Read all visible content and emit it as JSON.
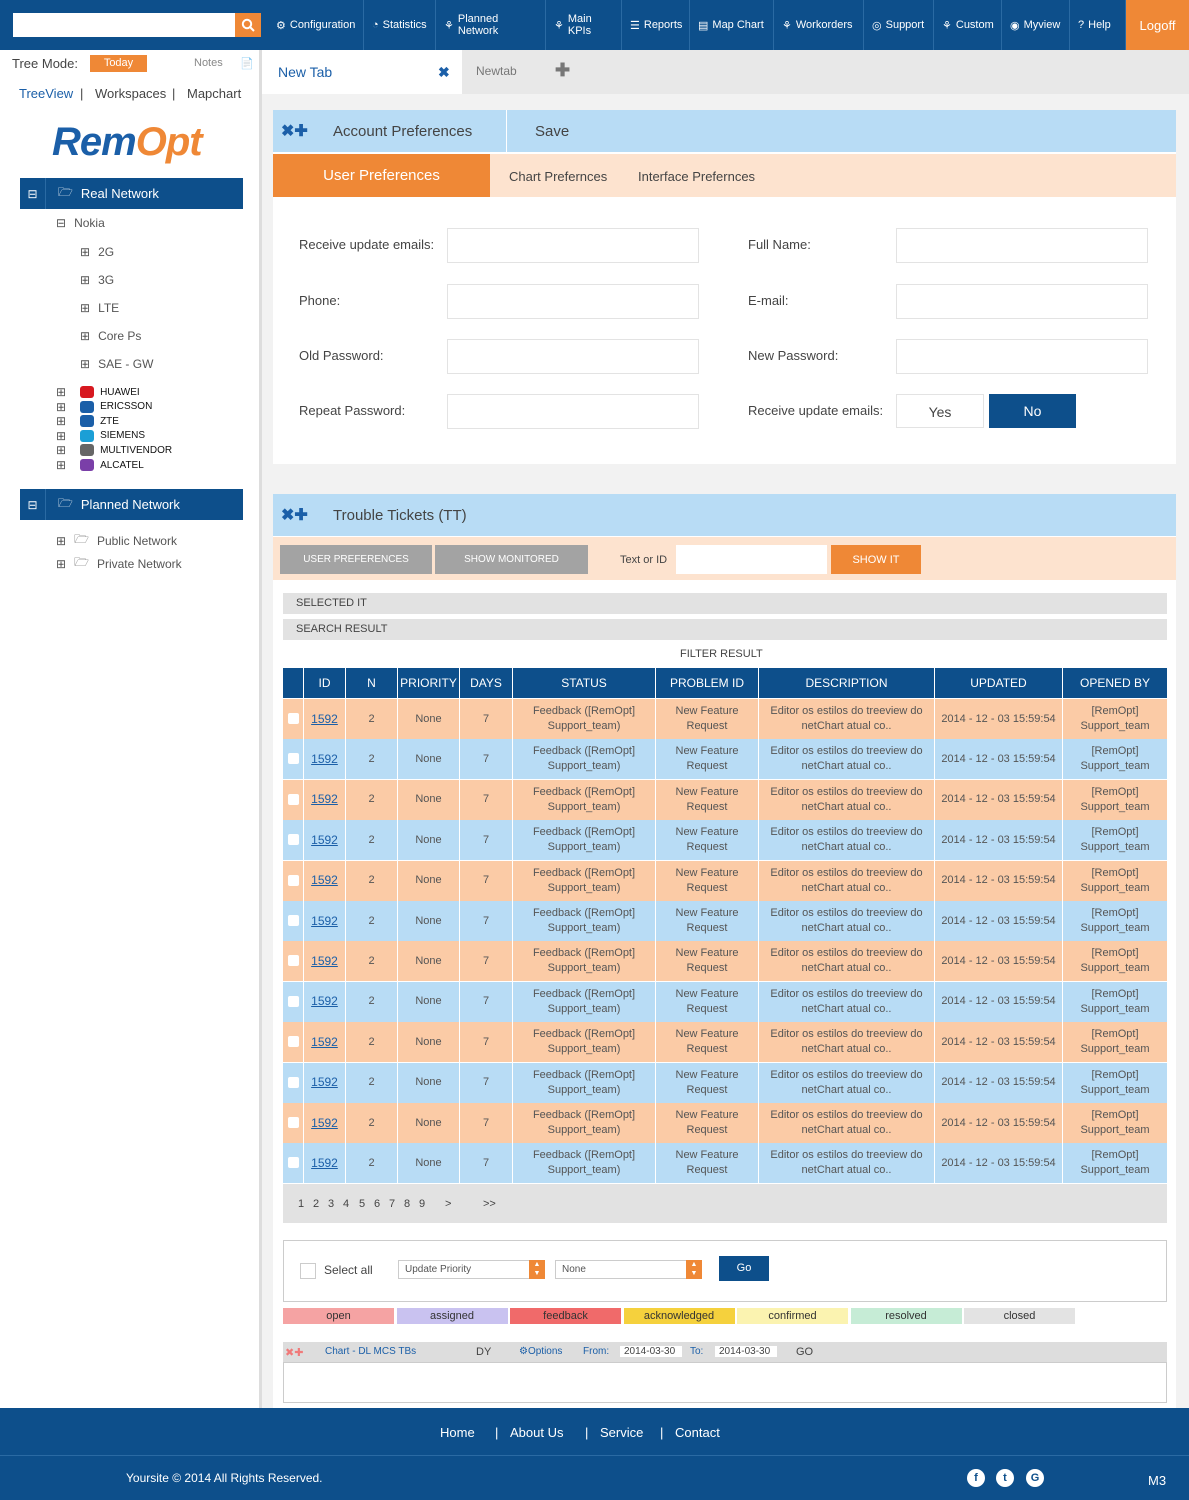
{
  "nav": {
    "search_placeholder": "",
    "items": [
      {
        "label": "Configuration",
        "icon": "gear-icon"
      },
      {
        "label": "Statistics",
        "icon": "pie-chart-icon"
      },
      {
        "label": "Planned Network",
        "icon": "network-icon"
      },
      {
        "label": "Main KPIs",
        "icon": "network-icon"
      },
      {
        "label": "Reports",
        "icon": "document-icon"
      },
      {
        "label": "Map Chart",
        "icon": "map-icon"
      },
      {
        "label": "Workorders",
        "icon": "network-icon"
      },
      {
        "label": "Support",
        "icon": "lifebuoy-icon"
      },
      {
        "label": "Custom",
        "icon": "network-icon"
      },
      {
        "label": "Myview",
        "icon": "globe-icon"
      },
      {
        "label": "Help",
        "icon": "question-icon"
      }
    ],
    "logoff": "Logoff"
  },
  "sidebar": {
    "tree_mode_label": "Tree Mode:",
    "today": "Today",
    "notes": "Notes",
    "views": [
      "TreeView",
      "Workspaces",
      "Mapchart"
    ],
    "separator": "|",
    "logo_a": "Rem",
    "logo_b": "Opt",
    "real_network": "Real Network",
    "nokia": "Nokia",
    "nokia_children": [
      "2G",
      "3G",
      "LTE",
      "Core Ps",
      "SAE - GW"
    ],
    "vendors": [
      "HUAWEI",
      "ERICSSON",
      "ZTE",
      "SIEMENS",
      "MULTIVENDOR",
      "ALCATEL"
    ],
    "planned_network": "Planned Network",
    "planned_children": [
      "Public Network",
      "Private Network"
    ]
  },
  "tabs": {
    "tab1": "New Tab",
    "tab2": "Newtab"
  },
  "account": {
    "title": "Account Preferences",
    "save": "Save",
    "subtabs": [
      "User Preferences",
      "Chart Prefernces",
      "Interface Prefernces"
    ],
    "fields": [
      {
        "label": "Receive update emails:"
      },
      {
        "label": "Full Name:"
      },
      {
        "label": "Phone:"
      },
      {
        "label": "E-mail:"
      },
      {
        "label": "Old Password:"
      },
      {
        "label": "New Password:"
      },
      {
        "label": "Repeat Password:"
      },
      {
        "label": "Receive update emails:"
      }
    ],
    "yes": "Yes",
    "no": "No"
  },
  "tickets": {
    "title": "Trouble Tickets (TT)",
    "user_prefs_btn": "USER PREFERENCES",
    "show_monitored_btn": "SHOW MONITORED",
    "text_or_id": "Text or ID",
    "show_it": "SHOW IT",
    "selected_it": "SELECTED IT",
    "search_result": "SEARCH RESULT",
    "filter_result": "FILTER RESULT",
    "columns": [
      "ID",
      "N",
      "PRIORITY",
      "DAYS",
      "STATUS",
      "PROBLEM ID",
      "DESCRIPTION",
      "UPDATED",
      "OPENED BY"
    ],
    "rows": [
      {
        "id": "1592",
        "n": "2",
        "priority": "None",
        "days": "7",
        "status": "Feedback ([RemOpt] Support_team)",
        "problem": "New Feature Request",
        "desc": "Editor os estilos do treeview do netChart atual co..",
        "updated": "2014 - 12 - 03  15:59:54",
        "opened": "[RemOpt] Support_team"
      },
      {
        "id": "1592",
        "n": "2",
        "priority": "None",
        "days": "7",
        "status": "Feedback ([RemOpt] Support_team)",
        "problem": "New Feature Request",
        "desc": "Editor os estilos do treeview do netChart atual co..",
        "updated": "2014 - 12 - 03  15:59:54",
        "opened": "[RemOpt] Support_team"
      },
      {
        "id": "1592",
        "n": "2",
        "priority": "None",
        "days": "7",
        "status": "Feedback ([RemOpt] Support_team)",
        "problem": "New Feature Request",
        "desc": "Editor os estilos do treeview do netChart atual co..",
        "updated": "2014 - 12 - 03  15:59:54",
        "opened": "[RemOpt] Support_team"
      },
      {
        "id": "1592",
        "n": "2",
        "priority": "None",
        "days": "7",
        "status": "Feedback ([RemOpt] Support_team)",
        "problem": "New Feature Request",
        "desc": "Editor os estilos do treeview do netChart atual co..",
        "updated": "2014 - 12 - 03  15:59:54",
        "opened": "[RemOpt] Support_team"
      },
      {
        "id": "1592",
        "n": "2",
        "priority": "None",
        "days": "7",
        "status": "Feedback ([RemOpt] Support_team)",
        "problem": "New Feature Request",
        "desc": "Editor os estilos do treeview do netChart atual co..",
        "updated": "2014 - 12 - 03  15:59:54",
        "opened": "[RemOpt] Support_team"
      },
      {
        "id": "1592",
        "n": "2",
        "priority": "None",
        "days": "7",
        "status": "Feedback ([RemOpt] Support_team)",
        "problem": "New Feature Request",
        "desc": "Editor os estilos do treeview do netChart atual co..",
        "updated": "2014 - 12 - 03  15:59:54",
        "opened": "[RemOpt] Support_team"
      },
      {
        "id": "1592",
        "n": "2",
        "priority": "None",
        "days": "7",
        "status": "Feedback ([RemOpt] Support_team)",
        "problem": "New Feature Request",
        "desc": "Editor os estilos do treeview do netChart atual co..",
        "updated": "2014 - 12 - 03  15:59:54",
        "opened": "[RemOpt] Support_team"
      },
      {
        "id": "1592",
        "n": "2",
        "priority": "None",
        "days": "7",
        "status": "Feedback ([RemOpt] Support_team)",
        "problem": "New Feature Request",
        "desc": "Editor os estilos do treeview do netChart atual co..",
        "updated": "2014 - 12 - 03  15:59:54",
        "opened": "[RemOpt] Support_team"
      },
      {
        "id": "1592",
        "n": "2",
        "priority": "None",
        "days": "7",
        "status": "Feedback ([RemOpt] Support_team)",
        "problem": "New Feature Request",
        "desc": "Editor os estilos do treeview do netChart atual co..",
        "updated": "2014 - 12 - 03  15:59:54",
        "opened": "[RemOpt] Support_team"
      },
      {
        "id": "1592",
        "n": "2",
        "priority": "None",
        "days": "7",
        "status": "Feedback ([RemOpt] Support_team)",
        "problem": "New Feature Request",
        "desc": "Editor os estilos do treeview do netChart atual co..",
        "updated": "2014 - 12 - 03  15:59:54",
        "opened": "[RemOpt] Support_team"
      },
      {
        "id": "1592",
        "n": "2",
        "priority": "None",
        "days": "7",
        "status": "Feedback ([RemOpt] Support_team)",
        "problem": "New Feature Request",
        "desc": "Editor os estilos do treeview do netChart atual co..",
        "updated": "2014 - 12 - 03  15:59:54",
        "opened": "[RemOpt] Support_team"
      },
      {
        "id": "1592",
        "n": "2",
        "priority": "None",
        "days": "7",
        "status": "Feedback ([RemOpt] Support_team)",
        "problem": "New Feature Request",
        "desc": "Editor os estilos do treeview do netChart atual co..",
        "updated": "2014 - 12 - 03  15:59:54",
        "opened": "[RemOpt] Support_team"
      }
    ],
    "pages": [
      "1",
      "2",
      "3",
      "4",
      "5",
      "6",
      "7",
      "8",
      "9",
      ">",
      ">>"
    ],
    "select_all": "Select all",
    "action_select": "Update Priority",
    "value_select": "None",
    "go": "Go",
    "statuses": [
      {
        "label": "open",
        "color": "#f5a3a3"
      },
      {
        "label": "assigned",
        "color": "#c9c2f0"
      },
      {
        "label": "feedback",
        "color": "#f06a6a"
      },
      {
        "label": "acknowledged",
        "color": "#f5d13d"
      },
      {
        "label": "confirmed",
        "color": "#fbf3b0"
      },
      {
        "label": "resolved",
        "color": "#c6ecd6"
      },
      {
        "label": "closed",
        "color": "#e3e3e3"
      }
    ],
    "chart": {
      "title": "Chart - DL MCS TBs",
      "dy": "DY",
      "options": "Options",
      "from_label": "From:",
      "from": "2014-03-30",
      "to_label": "To:",
      "to": "2014-03-30",
      "go": "GO"
    }
  },
  "footer": {
    "links": [
      "Home",
      "About Us",
      "Service",
      "Contact"
    ],
    "separator": "|",
    "copyright": "Yoursite © 2014 All Rights Reserved.",
    "social": [
      "facebook-icon",
      "twitter-icon",
      "google-icon"
    ],
    "version": "M3"
  },
  "colors": {
    "primary": "#0d4f8b",
    "accent": "#ef8836",
    "light_blue": "#b8dcf5",
    "light_orange": "#fde3cf",
    "row_orange": "#fbcba6"
  }
}
